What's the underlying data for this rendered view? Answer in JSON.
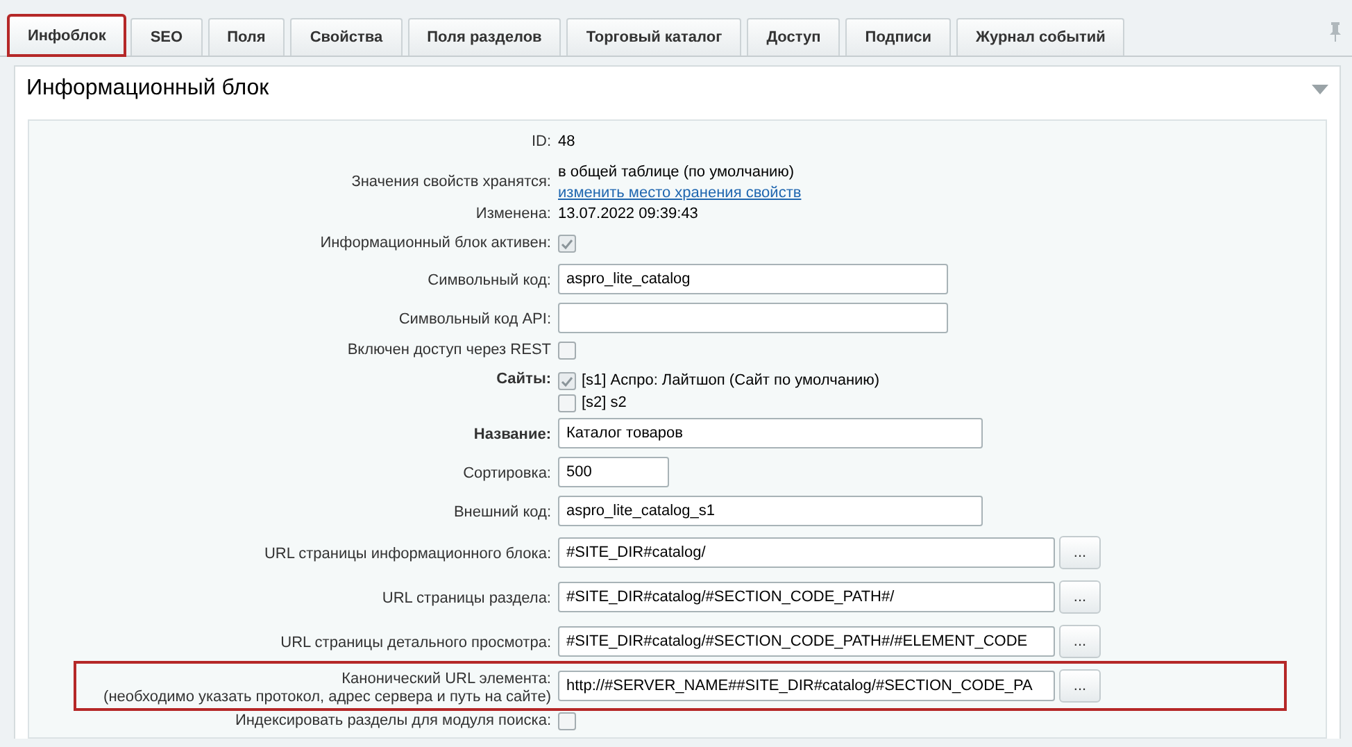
{
  "tabs": [
    {
      "label": "Инфоблок",
      "selected": true,
      "highlighted": true
    },
    {
      "label": "SEO",
      "selected": false,
      "highlighted": false
    },
    {
      "label": "Поля",
      "selected": false,
      "highlighted": false
    },
    {
      "label": "Свойства",
      "selected": false,
      "highlighted": false
    },
    {
      "label": "Поля разделов",
      "selected": false,
      "highlighted": false
    },
    {
      "label": "Торговый каталог",
      "selected": false,
      "highlighted": false
    },
    {
      "label": "Доступ",
      "selected": false,
      "highlighted": false
    },
    {
      "label": "Подписи",
      "selected": false,
      "highlighted": false
    },
    {
      "label": "Журнал событий",
      "selected": false,
      "highlighted": false
    }
  ],
  "panel": {
    "title": "Информационный блок",
    "expanded": true
  },
  "fields": [
    {
      "kind": "text",
      "label": "ID:",
      "required": false,
      "value": "48"
    },
    {
      "kind": "text",
      "label": "Значения свойств хранятся:",
      "required": false,
      "value": "в общей таблице (по умолчанию)",
      "link": "изменить место хранения свойств"
    },
    {
      "kind": "text",
      "label": "Изменена:",
      "required": false,
      "value": "13.07.2022 09:39:43"
    },
    {
      "kind": "checkbox",
      "label": "Информационный блок активен:",
      "required": false,
      "checked": true
    },
    {
      "kind": "input",
      "label": "Символьный код:",
      "required": false,
      "value": "aspro_lite_catalog"
    },
    {
      "kind": "input",
      "label": "Символьный код API:",
      "required": false
    },
    {
      "kind": "checkbox",
      "label": "Включен доступ через REST",
      "required": false,
      "checked": false
    },
    {
      "kind": "checklist",
      "label": "Сайты:",
      "required": true,
      "options": [
        {
          "label": "[s1] Аспро: Лайтшоп (Сайт по умолчанию)",
          "checked": true
        },
        {
          "label": "[s2] s2",
          "checked": false
        }
      ]
    },
    {
      "kind": "input-wide",
      "label": "Название:",
      "required": true,
      "value": "Каталог товаров"
    },
    {
      "kind": "input-narrow",
      "label": "Сортировка:",
      "required": false,
      "value": "500"
    },
    {
      "kind": "input-wide",
      "label": "Внешний код:",
      "required": false,
      "value": "aspro_lite_catalog_s1"
    },
    {
      "kind": "input-button",
      "label": "URL страницы информационного блока:",
      "required": false,
      "value": "#SITE_DIR#catalog/",
      "button": "...",
      "highlighted": false
    },
    {
      "kind": "input-button",
      "label": "URL страницы раздела:",
      "required": false,
      "value": "#SITE_DIR#catalog/#SECTION_CODE_PATH#/",
      "button": "...",
      "highlighted": false
    },
    {
      "kind": "input-button",
      "label": "URL страницы детального просмотра:",
      "required": false,
      "value": "#SITE_DIR#catalog/#SECTION_CODE_PATH#/#ELEMENT_CODE",
      "button": "...",
      "highlighted": false
    },
    {
      "kind": "input-button",
      "label": "Канонический URL элемента:",
      "sublabel": "(необходимо указать протокол, адрес сервера и путь на сайте)",
      "required": false,
      "value": "http://#SERVER_NAME##SITE_DIR#catalog/#SECTION_CODE_PA",
      "button": "...",
      "highlighted": true
    },
    {
      "kind": "checkbox",
      "label": "Индексировать разделы для модуля поиска:",
      "required": false,
      "checked": false
    }
  ]
}
